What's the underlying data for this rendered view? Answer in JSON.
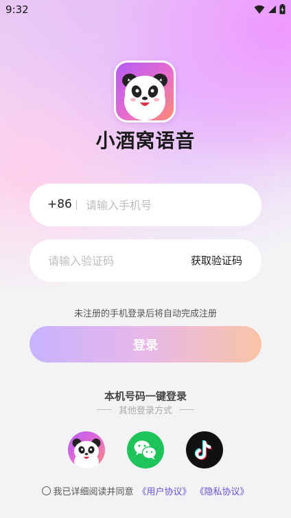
{
  "status_bar": {
    "time": "9:32",
    "icons": [
      "wifi-icon",
      "signal-icon",
      "battery-charging-icon"
    ]
  },
  "app": {
    "name": "小酒窝语音",
    "logo_icon": "panda-logo-icon"
  },
  "form": {
    "country_code": "+86",
    "phone_placeholder": "请输入手机号",
    "phone_value": "",
    "code_placeholder": "请输入验证码",
    "code_value": "",
    "get_code_label": "获取验证码"
  },
  "hint": "未注册的手机登录后将自动完成注册",
  "login_button": "登录",
  "one_key_login": "本机号码一键登录",
  "other_login": {
    "label": "其他登录方式",
    "options": [
      {
        "icon": "panda-icon"
      },
      {
        "icon": "wechat-icon"
      },
      {
        "icon": "tiktok-icon"
      }
    ]
  },
  "agreement": {
    "text": "我已详细阅读并同意",
    "user_agreement": "《用户协议》",
    "privacy_policy": "《隐私协议》",
    "checked": false
  },
  "colors": {
    "primary_gradient": [
      "#c8b2ff",
      "#f9c4a6"
    ],
    "link": "#6a4ed8",
    "wechat": "#1ec35a"
  }
}
